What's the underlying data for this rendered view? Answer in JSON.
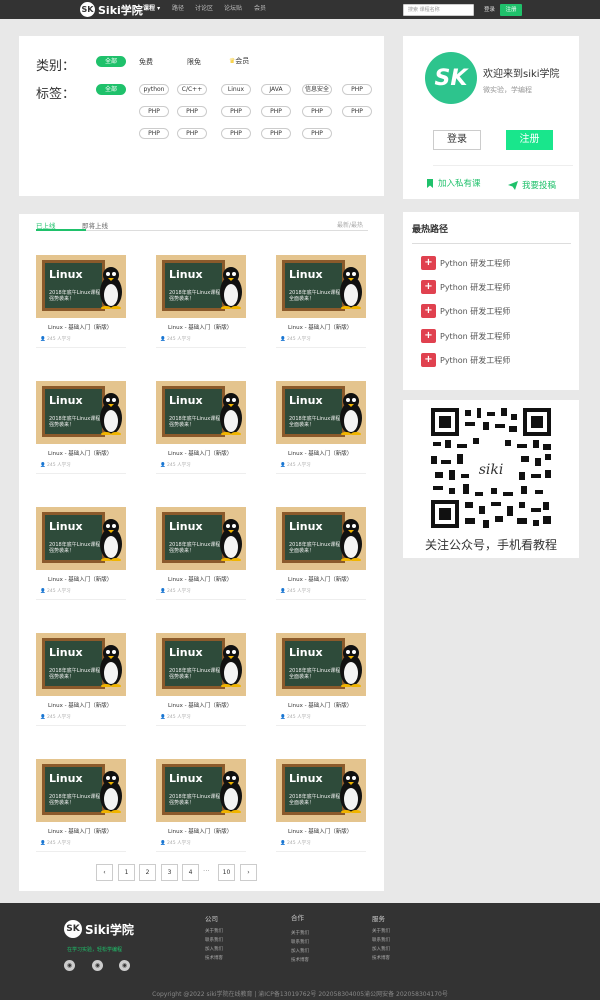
{
  "brand": {
    "logo_mark": "SK",
    "logo_text": "Siki学院"
  },
  "topnav": {
    "items": [
      "课程",
      "路径",
      "讨论区",
      "论坛贴",
      "会员"
    ],
    "search_placeholder": "搜索 课程名称",
    "login": "登录",
    "register": "注册",
    "active_color": "#1fc16b"
  },
  "filter": {
    "category_label": "类别：",
    "categories": [
      "全部",
      "免费",
      "限免",
      "会员"
    ],
    "tag_label": "标签：",
    "tags": [
      "全部",
      "python",
      "C/C++",
      "Linux",
      "JAVA",
      "信息安全",
      "PHP",
      "PHP",
      "PHP",
      "PHP",
      "PHP",
      "PHP",
      "PHP",
      "PHP",
      "PHP",
      "PHP",
      "PHP",
      "PHP"
    ]
  },
  "user": {
    "avatar_text": "SK",
    "welcome": "欢迎来到siki学院",
    "subtitle": "微实验，学编程",
    "login": "登录",
    "register": "注册",
    "join_private": "加入私有课",
    "contribute": "我要投稿"
  },
  "paths": {
    "title": "最热路径",
    "items": [
      "Python 研发工程师",
      "Python 研发工程师",
      "Python 研发工程师",
      "Python 研发工程师",
      "Python 研发工程师"
    ]
  },
  "qr": {
    "center_text": "siki",
    "caption": "关注公众号，手机看教程"
  },
  "courses": {
    "tab_online": "已上线",
    "tab_soon": "即将上线",
    "sort": "最新/最热",
    "board_title": "Linux",
    "board_sub1": "2018年底午Linux课程",
    "board_sub2": "强势袭来！",
    "board_sub2_alt": "全面袭来！",
    "items": [
      {
        "title": "Linux - 基础入门（新版）",
        "meta": "245 人学习"
      },
      {
        "title": "Linux - 基础入门（新版）",
        "meta": "245 人学习"
      },
      {
        "title": "Linux - 基础入门（新版）",
        "meta": "245 人学习"
      },
      {
        "title": "Linux - 基础入门（新版）",
        "meta": "245 人学习"
      },
      {
        "title": "Linux - 基础入门（新版）",
        "meta": "245 人学习"
      },
      {
        "title": "Linux - 基础入门（新版）",
        "meta": "245 人学习"
      },
      {
        "title": "Linux - 基础入门（新版）",
        "meta": "245 人学习"
      },
      {
        "title": "Linux - 基础入门（新版）",
        "meta": "245 人学习"
      },
      {
        "title": "Linux - 基础入门（新版）",
        "meta": "245 人学习"
      },
      {
        "title": "Linux - 基础入门（新版）",
        "meta": "245 人学习"
      },
      {
        "title": "Linux - 基础入门（新版）",
        "meta": "245 人学习"
      },
      {
        "title": "Linux - 基础入门（新版）",
        "meta": "245 人学习"
      },
      {
        "title": "Linux - 基础入门（新版）",
        "meta": "245 人学习"
      },
      {
        "title": "Linux - 基础入门（新版）",
        "meta": "245 人学习"
      },
      {
        "title": "Linux - 基础入门（新版）",
        "meta": "245 人学习"
      }
    ]
  },
  "pagination": {
    "prev": "‹",
    "pages": [
      "1",
      "2",
      "3",
      "4"
    ],
    "ellipsis": "···",
    "last": "10",
    "next": "›"
  },
  "footer": {
    "logo_mark": "SK",
    "logo_text": "Siki学院",
    "slogan": "在学习实验，轻松学编程",
    "cols": [
      {
        "title": "公司",
        "items": [
          "关于我们",
          "联系我们",
          "加入我们",
          "技术博客"
        ]
      },
      {
        "title": "合作",
        "items": [
          "关于我们",
          "联系我们",
          "加入我们",
          "技术博客"
        ]
      },
      {
        "title": "服务",
        "items": [
          "关于我们",
          "联系我们",
          "加入我们",
          "技术博客"
        ]
      }
    ],
    "copyright": "Copyright @2022 siki学院在线教育 | 渝ICP备13019762号 202058304005渝公网安备 202058304170号"
  }
}
